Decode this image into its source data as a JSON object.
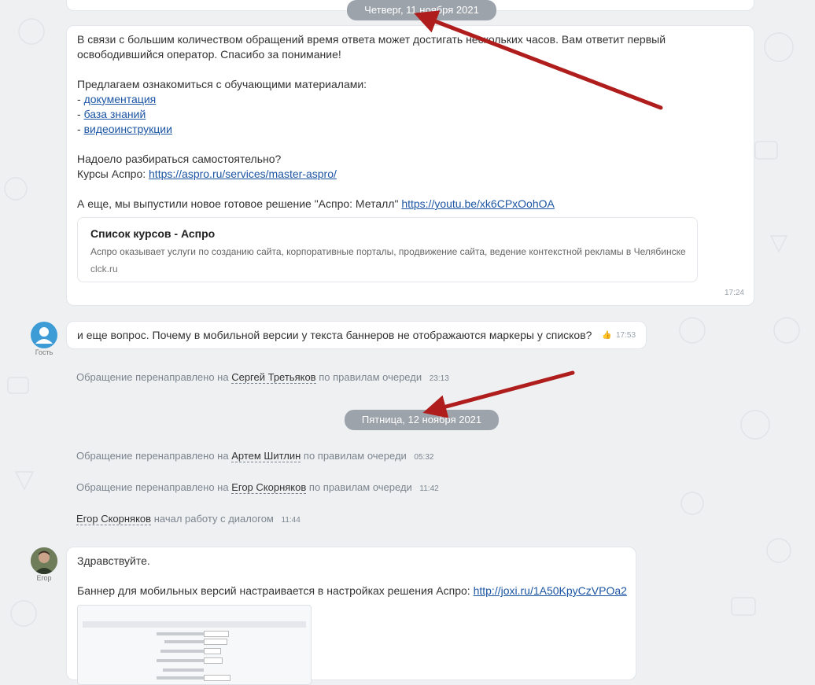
{
  "dates": {
    "thursday": "Четверг, 11 ноября 2021",
    "friday": "Пятница, 12 ноября 2021"
  },
  "message1": {
    "line1": "В связи с большим количеством обращений время ответа может достигать нескольких часов. Вам ответит первый",
    "line2": "освободившийся оператор. Спасибо за понимание!",
    "intro": "Предлагаем ознакомиться с обучающими материалами:",
    "dash": "-",
    "link_docs": "документация",
    "link_kb": "база знаний",
    "link_video": "видеоинструкции",
    "tired": "Надоело разбираться самостоятельно?",
    "courses_prefix": "Курсы Аспро:",
    "courses_link": "https://aspro.ru/services/master-aspro/",
    "metal_prefix": "А еще, мы выпустили новое готовое решение \"Аспро: Металл\"",
    "metal_link": "https://youtu.be/xk6CPxOohOA",
    "preview_title": "Список курсов - Аспро",
    "preview_desc": "Аспро оказывает услуги по созданию сайта, корпоративные порталы, продвижение сайта, ведение контекстной рекламы в Челябинске",
    "preview_domain": "clck.ru",
    "time": "17:24"
  },
  "guest": {
    "label": "Гость",
    "text": "и еще вопрос. Почему в мобильной версии у текста баннеров не отображаются маркеры у списков?",
    "time": "17:53"
  },
  "system": [
    {
      "prefix": "Обращение перенаправлено на",
      "name": "Сергей Третьяков",
      "suffix": "по правилам очереди",
      "time": "23:13"
    },
    {
      "prefix": "Обращение перенаправлено на",
      "name": "Артем Шитлин",
      "suffix": "по правилам очереди",
      "time": "05:32"
    },
    {
      "prefix": "Обращение перенаправлено на",
      "name": "Егор Скорняков",
      "suffix": "по правилам очереди",
      "time": "11:42"
    },
    {
      "prefix": "",
      "name": "Егор Скорняков",
      "suffix": "начал работу с диалогом",
      "time": "11:44"
    }
  ],
  "operator": {
    "label": "Егор",
    "greeting": "Здравствуйте.",
    "banner_prefix": "Баннер для мобильных версий настраивается в настройках решения Аспро:",
    "banner_link": "http://joxi.ru/1A50KpyCzVPOa2"
  },
  "colors": {
    "link": "#1b55a3",
    "date_pill": "#9da3ab",
    "arrow": "#b01d1d",
    "guest_avatar": "#3d9bd6"
  }
}
